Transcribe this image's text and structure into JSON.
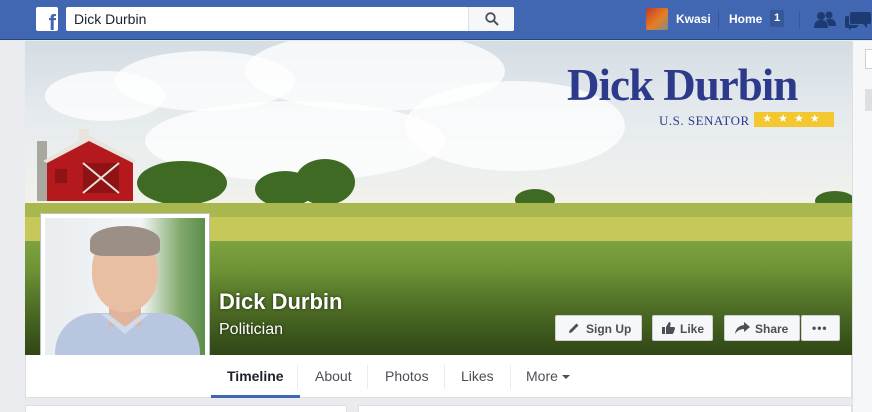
{
  "topbar": {
    "logo_letter": "f",
    "search_value": "Dick Durbin",
    "user_name": "Kwasi",
    "home_label": "Home",
    "home_count": "1"
  },
  "cover": {
    "brand_name": "Dick Durbin",
    "brand_title": "U.S. SENATOR",
    "brand_stars": "★★★★"
  },
  "page": {
    "name": "Dick Durbin",
    "category": "Politician"
  },
  "actions": {
    "sign_up": "Sign Up",
    "like": "Like",
    "share": "Share",
    "more": "•••"
  },
  "tabs": [
    "Timeline",
    "About",
    "Photos",
    "Likes",
    "More"
  ],
  "colors": {
    "brand_blue": "#4267b2",
    "senator_navy": "#2d3a8c",
    "star_gold": "#f4c62f"
  }
}
